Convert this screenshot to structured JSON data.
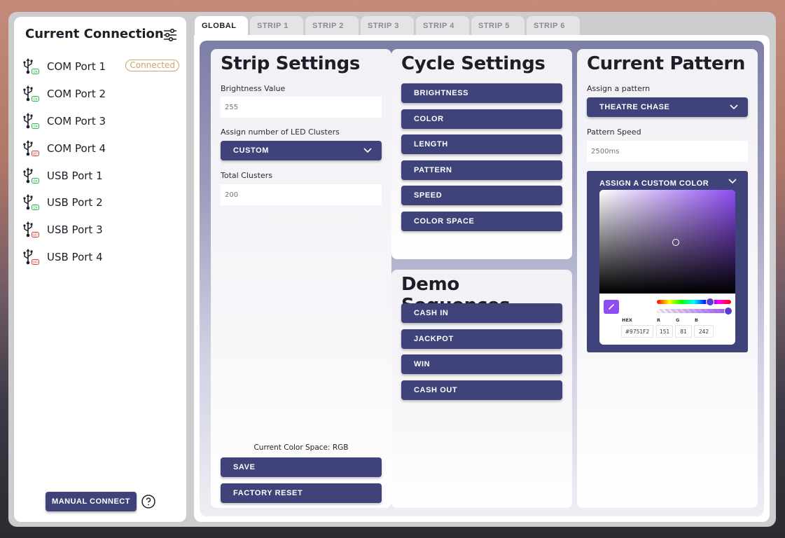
{
  "sidebar": {
    "title": "Current Connection",
    "ports": [
      {
        "label": "COM Port 1",
        "status": "ON",
        "badge": "Connected"
      },
      {
        "label": "COM Port 2",
        "status": "ON"
      },
      {
        "label": "COM Port 3",
        "status": "ON"
      },
      {
        "label": "COM Port 4",
        "status": "OFF"
      },
      {
        "label": "USB Port 1",
        "status": "ON"
      },
      {
        "label": "USB Port 2",
        "status": "ON"
      },
      {
        "label": "USB Port 3",
        "status": "OFF"
      },
      {
        "label": "USB Port 4",
        "status": "OFF"
      }
    ],
    "manual_connect": "MANUAL CONNECT"
  },
  "tabs": [
    "GLOBAL",
    "STRIP 1",
    "STRIP 2",
    "STRIP 3",
    "STRIP 4",
    "STRIP 5",
    "STRIP 6"
  ],
  "active_tab": "GLOBAL",
  "strip_settings": {
    "title": "Strip Settings",
    "brightness_label": "Brightness Value",
    "brightness_placeholder": "255",
    "clusters_label": "Assign number of LED Clusters",
    "clusters_value": "CUSTOM",
    "total_clusters_label": "Total Clusters",
    "total_clusters_placeholder": "200",
    "color_space_note": "Current Color Space: RGB",
    "save": "SAVE",
    "factory_reset": "FACTORY RESET"
  },
  "cycle_settings": {
    "title": "Cycle Settings",
    "buttons": [
      "BRIGHTNESS",
      "COLOR",
      "LENGTH",
      "PATTERN",
      "SPEED",
      "COLOR SPACE"
    ]
  },
  "demo_sequences": {
    "title": "Demo Sequences",
    "buttons": [
      "CASH IN",
      "JACKPOT",
      "WIN",
      "CASH OUT"
    ]
  },
  "current_pattern": {
    "title": "Current Pattern",
    "assign_label": "Assign a pattern",
    "pattern_value": "THEATRE CHASE",
    "speed_label": "Pattern Speed",
    "speed_placeholder": "2500ms",
    "custom_color_header": "ASSIGN A CUSTOM COLOR",
    "picker": {
      "hex_label": "HEX",
      "r_label": "R",
      "g_label": "G",
      "b_label": "B",
      "hex": "#9751F2",
      "r": "151",
      "g": "81",
      "b": "242"
    }
  },
  "colors": {
    "accent": "#3f437a",
    "connected": "#c8a56a",
    "status_on": "#2fb84a",
    "status_off": "#e0403a",
    "picked": "#9751F2"
  }
}
